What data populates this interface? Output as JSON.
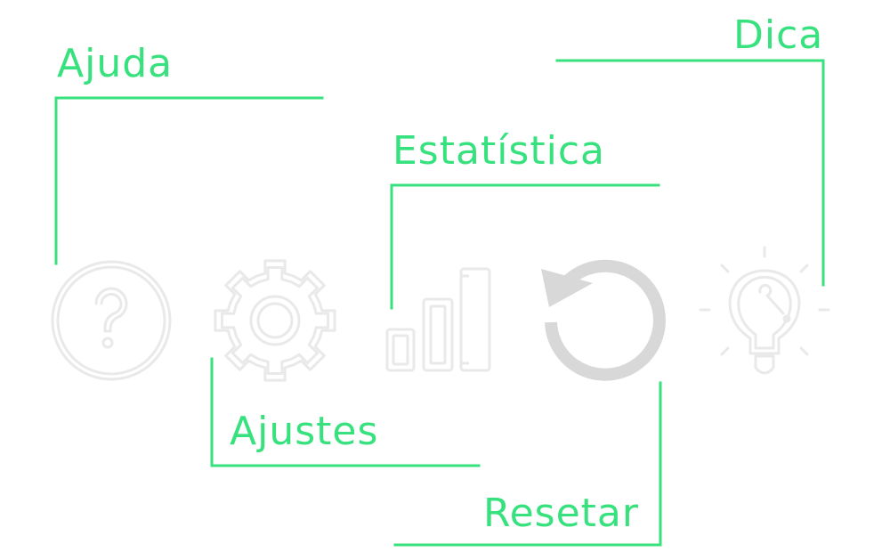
{
  "colors": {
    "accent": "#37e27e",
    "icon_stroke": "#e9e9e9",
    "icon_fill": "#d7d8d7",
    "background": "#ffffff"
  },
  "labels": {
    "help": "Ajuda",
    "settings": "Ajustes",
    "stats": "Estatística",
    "reset": "Resetar",
    "tip": "Dica"
  },
  "icons": {
    "help": "question-circle-icon",
    "settings": "gear-icon",
    "stats": "bar-chart-icon",
    "reset": "reset-icon",
    "tip": "lightbulb-icon"
  }
}
